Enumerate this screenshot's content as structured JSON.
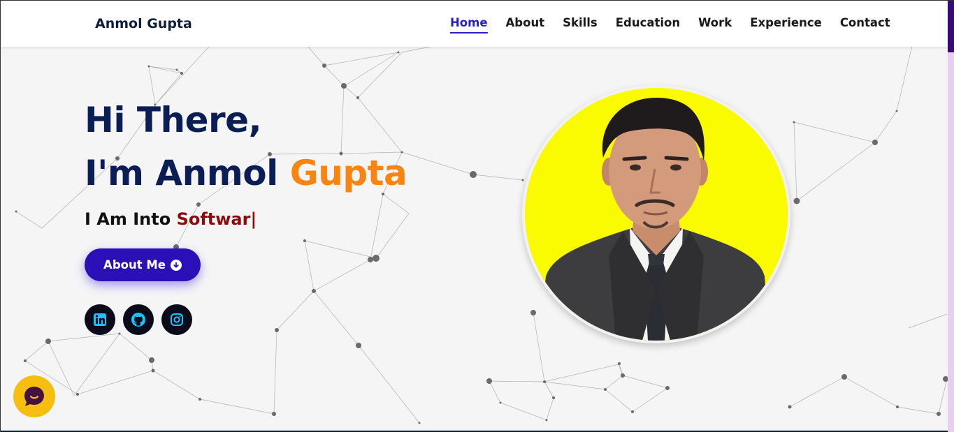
{
  "header": {
    "brand": "Anmol Gupta",
    "nav": [
      {
        "label": "Home",
        "active": true
      },
      {
        "label": "About",
        "active": false
      },
      {
        "label": "Skills",
        "active": false
      },
      {
        "label": "Education",
        "active": false
      },
      {
        "label": "Work",
        "active": false
      },
      {
        "label": "Experience",
        "active": false
      },
      {
        "label": "Contact",
        "active": false
      }
    ]
  },
  "hero": {
    "greeting": "Hi There,",
    "intro_prefix": "I'm Anmol ",
    "intro_name": "Gupta",
    "typing_prefix": "I Am Into ",
    "typing_word": "Softwar|",
    "button_label": "About Me",
    "button_icon": "arrow-down-circle-icon"
  },
  "social": [
    {
      "name": "linkedin-icon"
    },
    {
      "name": "github-icon"
    },
    {
      "name": "instagram-icon"
    }
  ],
  "colors": {
    "accent": "#2a10b6",
    "heading": "#0a1d55",
    "name_accent": "#f9840f",
    "typing_word": "#8e0b0b",
    "portrait_bg": "#fbfb00",
    "social_bg": "#0b0b1a",
    "social_icon": "#17c5ff",
    "chat_bg": "#f6bf10"
  },
  "chat": {
    "icon": "chat-bubble-icon"
  }
}
